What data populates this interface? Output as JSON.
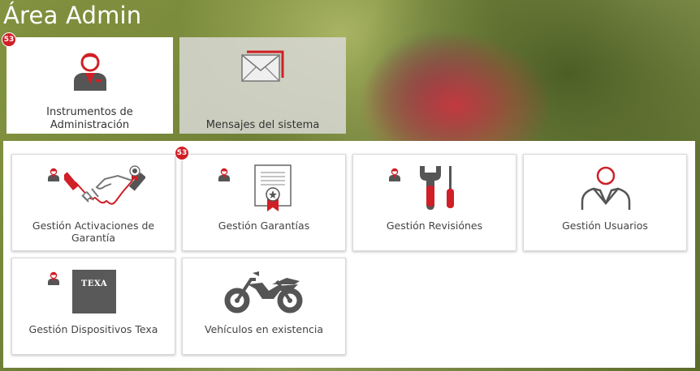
{
  "page": {
    "title": "Área Admin"
  },
  "top_tiles": [
    {
      "label": "Instrumentos de Administración",
      "badge": "53",
      "active": true
    },
    {
      "label": "Mensajes del sistema",
      "active": false
    }
  ],
  "cards": [
    {
      "label": "Gestión Activaciones de Garantía",
      "icon": "handshake-icon"
    },
    {
      "label": "Gestión Garantías",
      "icon": "certificate-icon",
      "badge": "53"
    },
    {
      "label": "Gestión Revisiónes",
      "icon": "wrench-screwdriver-icon"
    },
    {
      "label": "Gestión Usuarios",
      "icon": "user-outline-icon"
    },
    {
      "label": "Gestión Dispositivos Texa",
      "icon": "texa-device-icon",
      "device_text": "TEXA"
    },
    {
      "label": "Vehículos en existencia",
      "icon": "motorcycle-icon"
    }
  ],
  "colors": {
    "accent": "#d01f26",
    "icon_gray": "#555555"
  }
}
